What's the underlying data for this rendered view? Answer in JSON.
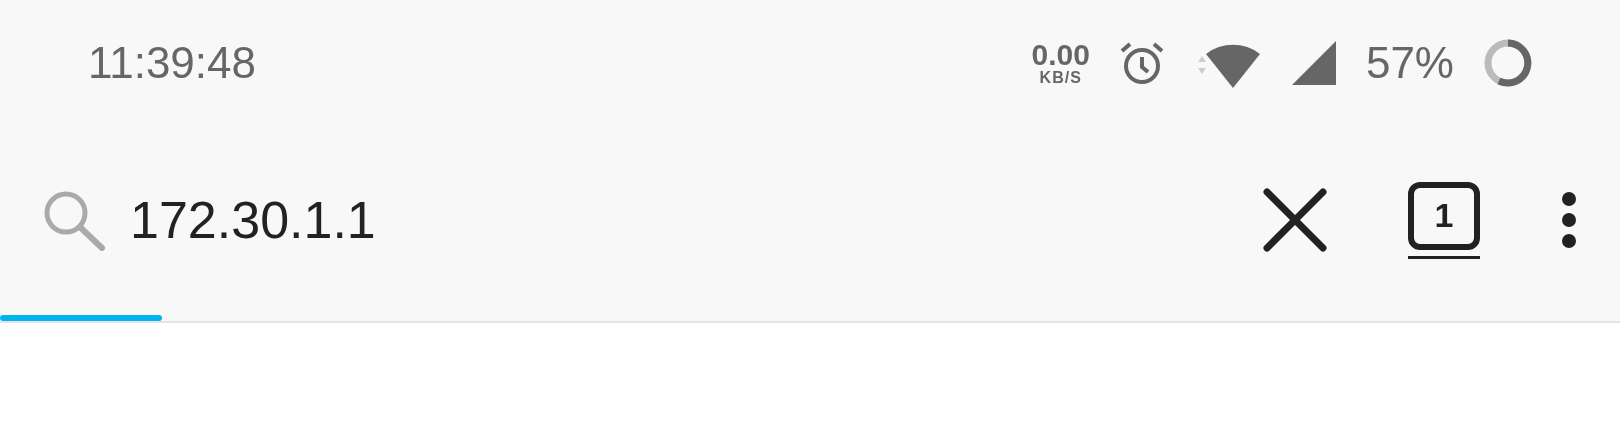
{
  "status_bar": {
    "time": "11:39:48",
    "net_speed": "0.00",
    "net_unit": "KB/S",
    "battery": "57%"
  },
  "address_bar": {
    "value": "172.30.1.1",
    "tab_count": "1"
  },
  "progress": {
    "level": 0.1
  }
}
